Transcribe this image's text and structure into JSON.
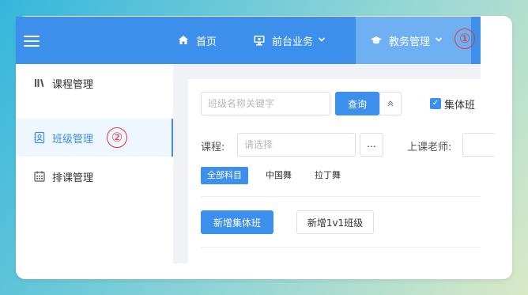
{
  "topbar": {
    "nav": [
      {
        "label": "首页",
        "icon": "home-icon"
      },
      {
        "label": "前台业务",
        "icon": "monitor-icon"
      },
      {
        "label": "教务管理",
        "icon": "graduation-cap-icon"
      }
    ],
    "marker_1": "①",
    "accent": "#3c8fea"
  },
  "sidebar": {
    "items": [
      {
        "label": "课程管理",
        "icon": "books-icon"
      },
      {
        "label": "班级管理",
        "icon": "contact-card-icon"
      },
      {
        "label": "排课管理",
        "icon": "calendar-icon"
      }
    ],
    "marker_2": "②"
  },
  "filters": {
    "search_placeholder": "班级名称关键字",
    "query_label": "查询",
    "checkbox_label": "集体班",
    "course_label": "课程:",
    "course_placeholder": "请选择",
    "more_label": "...",
    "teacher_label": "上课老师:",
    "tags": [
      "全部科目",
      "中国舞",
      "拉丁舞"
    ]
  },
  "actions": {
    "new_group": "新增集体班",
    "new_1v1": "新增1v1班级"
  }
}
